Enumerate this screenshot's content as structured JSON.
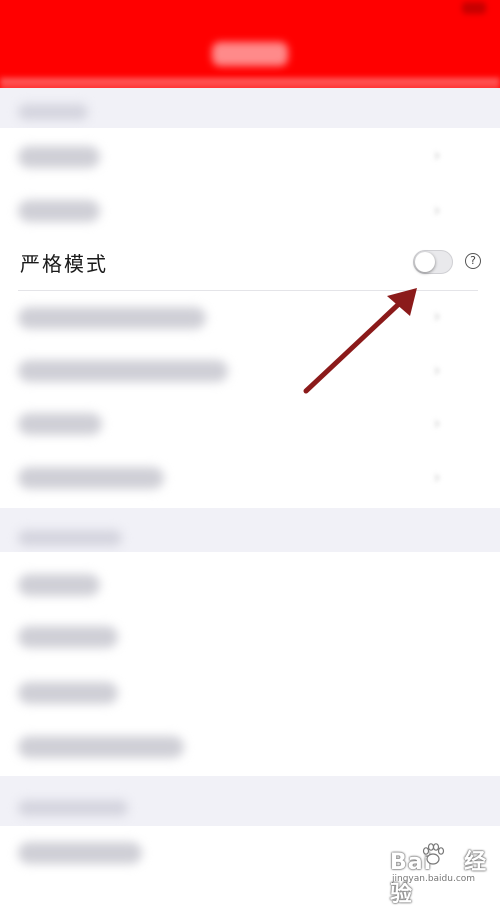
{
  "header": {
    "title": ""
  },
  "strict_mode": {
    "label": "严格模式",
    "toggle_on": false,
    "help_symbol": "?"
  },
  "icons": {
    "row_chevron": "chevron-right-icon",
    "help": "help-circle-icon"
  },
  "annotation": {
    "arrow_color": "#8b1a1a"
  },
  "watermark": {
    "brand": "Bai",
    "brand_suffix": "经验",
    "url": "jingyan.baidu.com"
  },
  "colors": {
    "header": "#ff0000",
    "section_bg": "#f1f1f7",
    "row_bg": "#ffffff"
  }
}
